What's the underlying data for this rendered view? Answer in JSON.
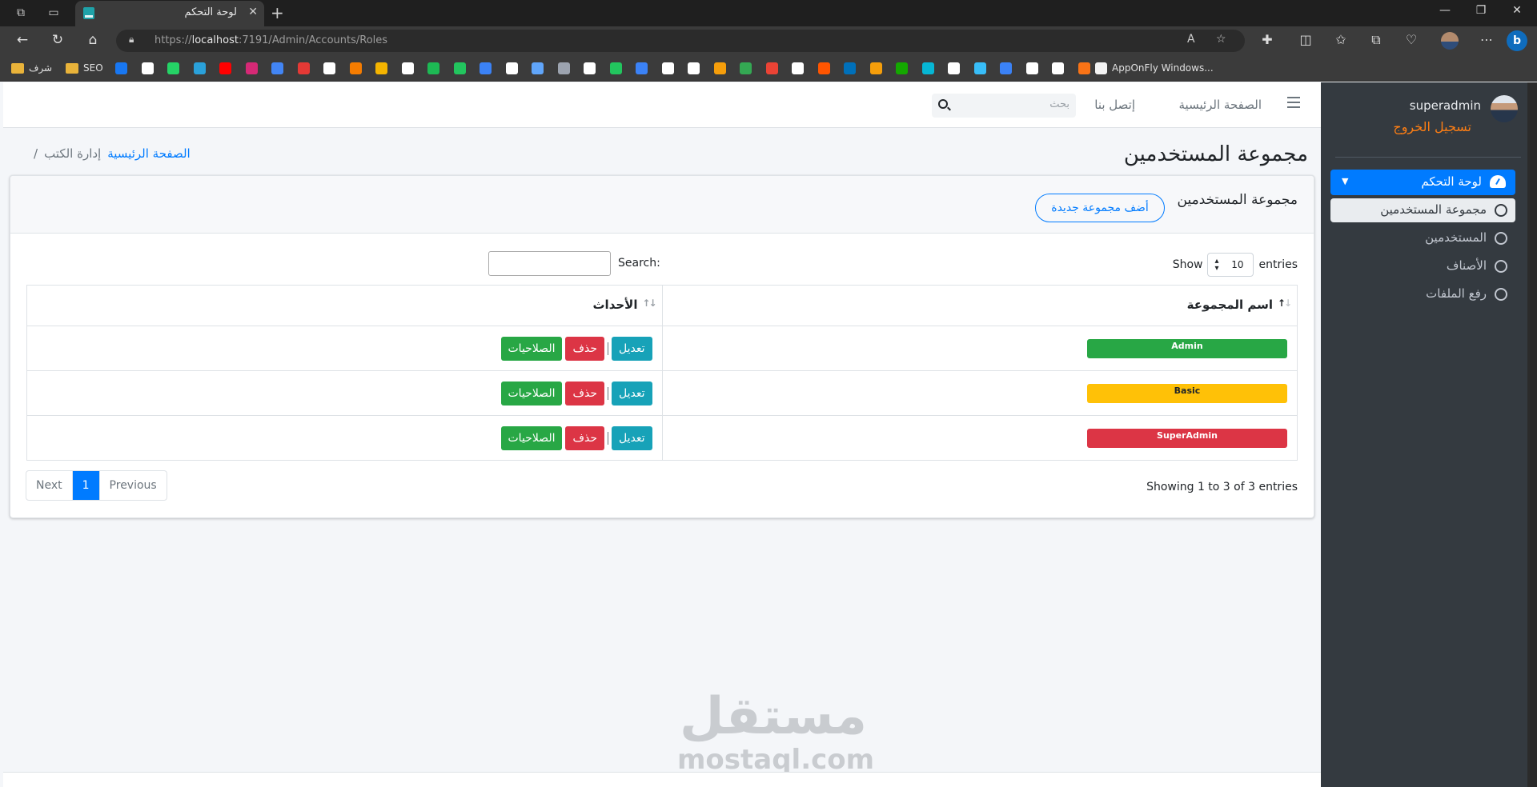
{
  "browser": {
    "tab_title": "لوحة التحكم",
    "url_scheme": "https://",
    "url_host": "localhost",
    "url_path": ":7191/Admin/Accounts/Roles",
    "bookmarks": [
      {
        "label": "شرف",
        "icon": "folder-icon"
      },
      {
        "label": "SEO",
        "icon": "folder-icon"
      },
      {
        "label": "AppOnFly Windows...",
        "icon": "page-icon"
      }
    ],
    "bookmark_icon_colors": [
      "#1877f2",
      "#ffffff",
      "#25d366",
      "#2aa1da",
      "#ff0000",
      "#d62976",
      "#4285f4",
      "#e53935",
      "#ffffff",
      "#f57c00",
      "#f4b400",
      "#ffffff",
      "#1db954",
      "#22c55e",
      "#3b82f6",
      "#ffffff",
      "#60a5fa",
      "#9ca3af",
      "#ffffff",
      "#22c55e",
      "#3b82f6",
      "#ffffff",
      "#ffffff",
      "#f59e0b",
      "#34a853",
      "#ea4335",
      "#ffffff",
      "#ff5500",
      "#0070ba",
      "#f59e0b",
      "#14a800",
      "#06b6d4",
      "#ffffff",
      "#38bdf8",
      "#3b82f6",
      "#ffffff",
      "#ffffff",
      "#f97316"
    ]
  },
  "sidebar": {
    "username": "superadmin",
    "logout": "تسجيل الخروج",
    "dashboard": "لوحة التحكم",
    "items": [
      {
        "label": "مجموعة المستخدمين",
        "active": true
      },
      {
        "label": "المستخدمين",
        "active": false
      },
      {
        "label": "الأصناف",
        "active": false
      },
      {
        "label": "رفع الملفات",
        "active": false
      }
    ]
  },
  "topnav": {
    "home": "الصفحة الرئيسية",
    "contact": "إتصل بنا",
    "search_placeholder": "بحث"
  },
  "page": {
    "title": "مجموعة المستخدمين",
    "breadcrumb_home": "الصفحة الرئيسية",
    "breadcrumb_current": "إدارة الكتب",
    "breadcrumb_sep": "/"
  },
  "card": {
    "title": "مجموعة المستخدمين",
    "add_button": "أضف مجموعة جديدة"
  },
  "datatable": {
    "show": "Show",
    "entries": "entries",
    "page_size": "10",
    "search_label": "Search:",
    "columns": [
      "اسم المجموعة",
      "الأحداث"
    ],
    "rows": [
      {
        "role": "Admin",
        "color": "#28a745",
        "text_color": "#ffffff"
      },
      {
        "role": "Basic",
        "color": "#ffc107",
        "text_color": "#212529"
      },
      {
        "role": "SuperAdmin",
        "color": "#dc3545",
        "text_color": "#ffffff"
      }
    ],
    "actions": {
      "edit": "تعديل",
      "delete": "حذف",
      "permissions": "الصلاحيات"
    },
    "info": "Showing 1 to 3 of 3 entries",
    "pagination": {
      "next": "Next",
      "current": "1",
      "previous": "Previous"
    }
  },
  "watermark": {
    "arabic": "مستقل",
    "latin": "mostaql.com"
  }
}
